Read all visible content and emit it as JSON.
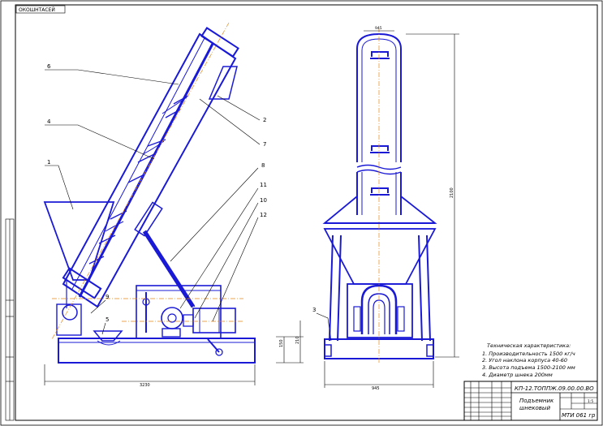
{
  "stamp_top_left": "ОКОШНТАСЕЙ",
  "title_block": {
    "code": "КП-12.ТОППЖ.09.00.00.ВО",
    "name_line1": "Подъемник",
    "name_line2": "шнековый",
    "org": "МТИ 061 гр",
    "scale": "1:5"
  },
  "specs": {
    "heading": "Техническая характеристика:",
    "items": [
      "1. Производительность 1500 кг/ч",
      "2. Угол наклона корпуса 40-60",
      "3. Высота подъема 1500-2100 мм",
      "4. Диаметр шнека 200мм"
    ]
  },
  "callouts": [
    "1",
    "2",
    "3",
    "4",
    "5",
    "6",
    "7",
    "8",
    "9",
    "10",
    "11",
    "12"
  ],
  "dims": {
    "front_width": "3230",
    "height_210": "210",
    "height_150": "150",
    "side_width": "945",
    "side_height": "2100",
    "top_width": "945"
  }
}
